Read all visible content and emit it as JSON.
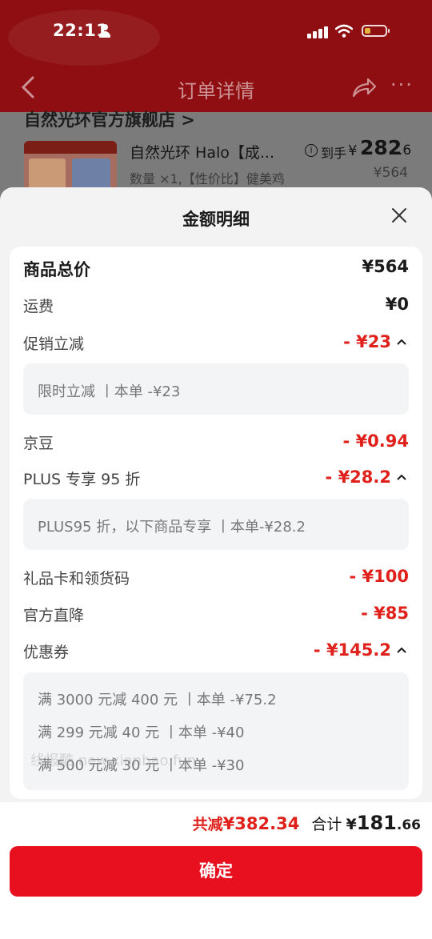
{
  "status_bar": {
    "time": "22:11"
  },
  "nav": {
    "title": "订单详情"
  },
  "store": {
    "name": "自然光环官方旗舰店 >"
  },
  "product": {
    "title": "自然光环 Halo【成...",
    "subtitle": "数量 ×1,【性价比】健美鸡",
    "price_label": "到手",
    "price_yen": "¥",
    "price_integer": "282",
    "price_decimal": ".6",
    "original_price": "¥564"
  },
  "sheet": {
    "title": "金额明细",
    "rows": {
      "total": {
        "label": "商品总价",
        "value": "¥564"
      },
      "shipping": {
        "label": "运费",
        "value": "¥0"
      },
      "promo": {
        "label": "促销立减",
        "value": "- ¥23",
        "details": [
          "限时立减 丨本单 -¥23"
        ]
      },
      "jingdou": {
        "label": "京豆",
        "value": "- ¥0.94"
      },
      "plus": {
        "label": "PLUS 专享 95 折",
        "value": "- ¥28.2",
        "details": [
          "PLUS95 折，以下商品专享 丨本单-¥28.2"
        ]
      },
      "giftcard": {
        "label": "礼品卡和领货码",
        "value": "- ¥100"
      },
      "official": {
        "label": "官方直降",
        "value": "- ¥85"
      },
      "coupon": {
        "label": "优惠券",
        "value": "- ¥145.2",
        "details": [
          "满 3000 元减 400 元 丨本单 -¥75.2",
          "满 299 元减 40 元 丨本单 -¥40",
          "满 500 元减 30 元 丨本单 -¥30"
        ]
      }
    },
    "summary": {
      "saved_label": "共减",
      "saved_amount": "¥382.34",
      "total_label": "合计",
      "total_yen": "¥",
      "total_integer": "181",
      "total_decimal": ".66"
    },
    "confirm_label": "确定"
  },
  "watermark": "线报酷 new.xianbao.fun",
  "colors": {
    "accent_red": "#e0201a",
    "button_red": "#e8101f",
    "header_red": "#8f0e12"
  }
}
